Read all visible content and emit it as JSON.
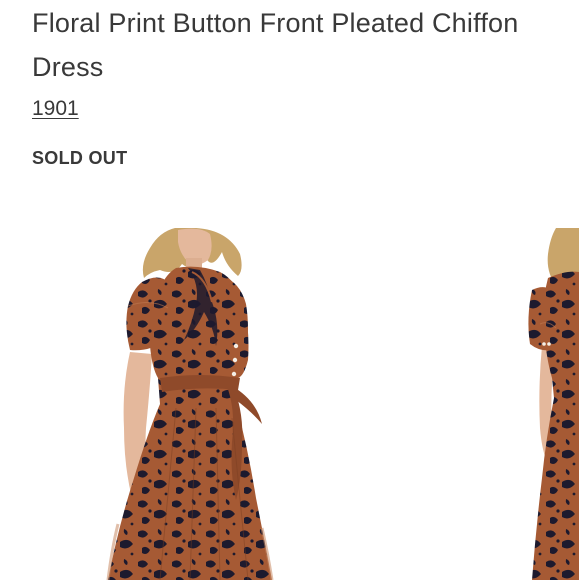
{
  "product": {
    "title": "Floral Print Button Front Pleated Chiffon Dress",
    "brand": "1901",
    "status": "SOLD OUT"
  },
  "gallery": {
    "images": [
      {
        "name": "product-image-primary"
      },
      {
        "name": "product-image-secondary"
      }
    ]
  },
  "colors": {
    "text": "#393939",
    "dress_rust": "#a65a34",
    "dress_navy": "#1d1a2e",
    "hair": "#c9a56a",
    "skin": "#e4b89c"
  }
}
